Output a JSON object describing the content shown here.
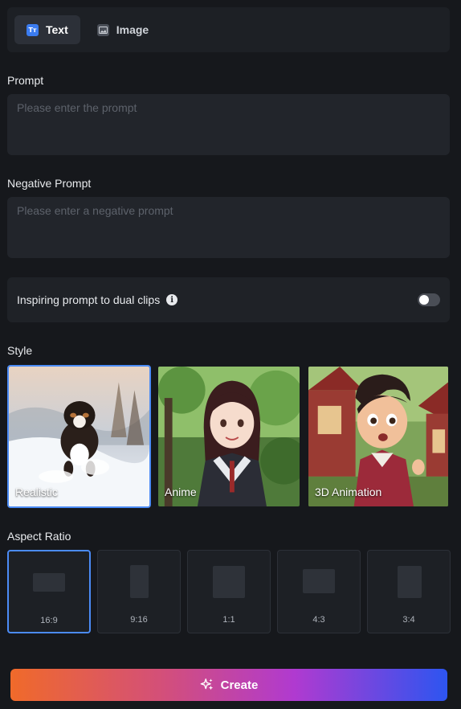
{
  "tabs": [
    {
      "label": "Text",
      "icon": "text-icon",
      "active": true
    },
    {
      "label": "Image",
      "icon": "image-icon",
      "active": false
    }
  ],
  "prompt": {
    "label": "Prompt",
    "placeholder": "Please enter the prompt",
    "value": ""
  },
  "negative_prompt": {
    "label": "Negative Prompt",
    "placeholder": "Please enter a negative prompt",
    "value": ""
  },
  "dual_clips": {
    "label": "Inspiring prompt to dual clips",
    "enabled": false
  },
  "style": {
    "label": "Style",
    "options": [
      {
        "label": "Realistic",
        "selected": true
      },
      {
        "label": "Anime",
        "selected": false
      },
      {
        "label": "3D Animation",
        "selected": false
      }
    ]
  },
  "aspect_ratio": {
    "label": "Aspect Ratio",
    "options": [
      {
        "label": "16:9",
        "selected": true
      },
      {
        "label": "9:16",
        "selected": false
      },
      {
        "label": "1:1",
        "selected": false
      },
      {
        "label": "4:3",
        "selected": false
      },
      {
        "label": "3:4",
        "selected": false
      }
    ]
  },
  "create_button": {
    "label": "Create",
    "icon": "sparkle-icon"
  },
  "colors": {
    "accent": "#4b8bf5",
    "background": "#16181c",
    "panel": "#22252b"
  }
}
